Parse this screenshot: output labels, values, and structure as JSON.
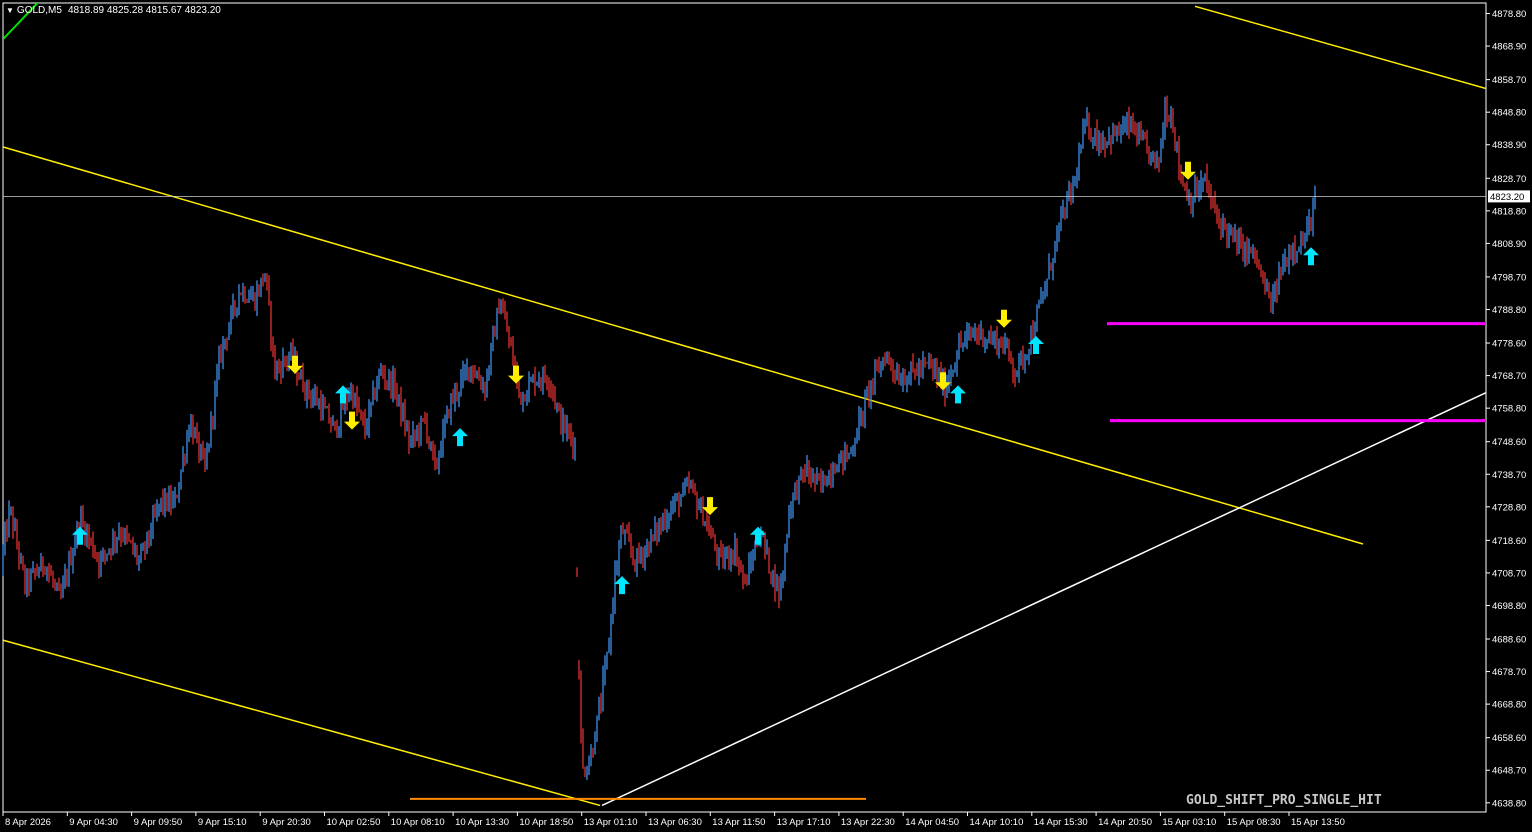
{
  "header": {
    "symbol": "GOLD,M5",
    "ohlc": "4818.89 4825.28 4815.67 4823.20"
  },
  "watermark": "GOLD_SHIFT_PRO_SINGLE_HIT",
  "current_price_label": "4823.20",
  "colors": {
    "background": "#000000",
    "candle_up": "#3d8ee8",
    "candle_down": "#e03030",
    "trend_line": "#ffee00",
    "support_line": "#ffffff",
    "zone_line": "#ff00ff",
    "low_line": "#ff8c00",
    "green_line": "#00e000",
    "arrow_up": "#00e5ff",
    "arrow_down": "#ffee00",
    "axis_text": "#ffffff",
    "grid_frame": "#ffffff"
  },
  "chart_data": {
    "type": "candlestick",
    "ylim": [
      4636.0,
      4882.0
    ],
    "y_ticks": [
      "4878.80",
      "4868.90",
      "4858.70",
      "4848.80",
      "4838.90",
      "4828.70",
      "4818.80",
      "4808.90",
      "4798.70",
      "4788.80",
      "4778.60",
      "4768.70",
      "4758.80",
      "4748.60",
      "4738.70",
      "4728.80",
      "4718.60",
      "4708.70",
      "4698.80",
      "4688.60",
      "4678.70",
      "4668.80",
      "4658.60",
      "4648.70",
      "4638.80"
    ],
    "x_ticks": [
      "8 Apr 2026",
      "9 Apr 04:30",
      "9 Apr 09:50",
      "9 Apr 15:10",
      "9 Apr 20:30",
      "10 Apr 02:50",
      "10 Apr 08:10",
      "10 Apr 13:30",
      "10 Apr 18:50",
      "13 Apr 01:10",
      "13 Apr 06:30",
      "13 Apr 11:50",
      "13 Apr 17:10",
      "13 Apr 22:30",
      "14 Apr 04:50",
      "14 Apr 10:10",
      "14 Apr 15:30",
      "14 Apr 20:50",
      "15 Apr 03:10",
      "15 Apr 08:30",
      "15 Apr 13:50"
    ],
    "current_price": 4823.2,
    "price_path": [
      [
        0,
        4710
      ],
      [
        10,
        4728
      ],
      [
        25,
        4705
      ],
      [
        45,
        4712
      ],
      [
        60,
        4700
      ],
      [
        80,
        4725
      ],
      [
        100,
        4712
      ],
      [
        120,
        4722
      ],
      [
        140,
        4712
      ],
      [
        160,
        4730
      ],
      [
        175,
        4730
      ],
      [
        190,
        4755
      ],
      [
        205,
        4740
      ],
      [
        220,
        4775
      ],
      [
        240,
        4795
      ],
      [
        255,
        4792
      ],
      [
        265,
        4800
      ],
      [
        275,
        4770
      ],
      [
        290,
        4775
      ],
      [
        305,
        4765
      ],
      [
        320,
        4760
      ],
      [
        335,
        4752
      ],
      [
        350,
        4765
      ],
      [
        365,
        4752
      ],
      [
        380,
        4770
      ],
      [
        395,
        4765
      ],
      [
        410,
        4748
      ],
      [
        425,
        4755
      ],
      [
        435,
        4740
      ],
      [
        450,
        4760
      ],
      [
        470,
        4772
      ],
      [
        485,
        4765
      ],
      [
        500,
        4792
      ],
      [
        510,
        4778
      ],
      [
        520,
        4762
      ],
      [
        535,
        4768
      ],
      [
        550,
        4768
      ],
      [
        560,
        4755
      ],
      [
        575,
        4748
      ],
      [
        578,
        4690
      ],
      [
        582,
        4648
      ],
      [
        590,
        4652
      ],
      [
        600,
        4668
      ],
      [
        608,
        4685
      ],
      [
        615,
        4708
      ],
      [
        622,
        4722
      ],
      [
        635,
        4712
      ],
      [
        650,
        4718
      ],
      [
        670,
        4728
      ],
      [
        690,
        4735
      ],
      [
        705,
        4725
      ],
      [
        720,
        4712
      ],
      [
        735,
        4716
      ],
      [
        745,
        4705
      ],
      [
        760,
        4722
      ],
      [
        770,
        4710
      ],
      [
        780,
        4702
      ],
      [
        790,
        4730
      ],
      [
        805,
        4740
      ],
      [
        820,
        4735
      ],
      [
        835,
        4742
      ],
      [
        850,
        4745
      ],
      [
        860,
        4755
      ],
      [
        870,
        4765
      ],
      [
        885,
        4775
      ],
      [
        900,
        4768
      ],
      [
        915,
        4770
      ],
      [
        930,
        4772
      ],
      [
        945,
        4765
      ],
      [
        960,
        4778
      ],
      [
        975,
        4782
      ],
      [
        990,
        4780
      ],
      [
        1005,
        4778
      ],
      [
        1015,
        4770
      ],
      [
        1025,
        4775
      ],
      [
        1035,
        4785
      ],
      [
        1045,
        4795
      ],
      [
        1060,
        4815
      ],
      [
        1075,
        4828
      ],
      [
        1085,
        4845
      ],
      [
        1100,
        4840
      ],
      [
        1115,
        4842
      ],
      [
        1130,
        4845
      ],
      [
        1145,
        4838
      ],
      [
        1158,
        4832
      ],
      [
        1165,
        4850
      ],
      [
        1172,
        4848
      ],
      [
        1180,
        4830
      ],
      [
        1190,
        4822
      ],
      [
        1205,
        4828
      ],
      [
        1215,
        4818
      ],
      [
        1228,
        4812
      ],
      [
        1240,
        4808
      ],
      [
        1255,
        4805
      ],
      [
        1265,
        4795
      ],
      [
        1272,
        4790
      ],
      [
        1280,
        4800
      ],
      [
        1292,
        4808
      ],
      [
        1305,
        4810
      ],
      [
        1316,
        4823
      ]
    ],
    "signals": [
      {
        "type": "up",
        "x": 80,
        "price": 4720
      },
      {
        "type": "down",
        "x": 295,
        "price": 4772
      },
      {
        "type": "up",
        "x": 343,
        "price": 4763
      },
      {
        "type": "down",
        "x": 352,
        "price": 4755
      },
      {
        "type": "up",
        "x": 460,
        "price": 4750
      },
      {
        "type": "down",
        "x": 516,
        "price": 4769
      },
      {
        "type": "up",
        "x": 622,
        "price": 4705
      },
      {
        "type": "down",
        "x": 710,
        "price": 4729
      },
      {
        "type": "up",
        "x": 758,
        "price": 4720
      },
      {
        "type": "down",
        "x": 943,
        "price": 4767
      },
      {
        "type": "up",
        "x": 958,
        "price": 4763
      },
      {
        "type": "down",
        "x": 1004,
        "price": 4786
      },
      {
        "type": "up",
        "x": 1036,
        "price": 4778
      },
      {
        "type": "down",
        "x": 1188,
        "price": 4831
      },
      {
        "type": "up",
        "x": 1311,
        "price": 4805
      }
    ],
    "lines": [
      {
        "kind": "trend",
        "p1": [
          0,
          4838.5
        ],
        "p2": [
          1363,
          4717.5
        ]
      },
      {
        "kind": "trend",
        "p1": [
          1195,
          4881
        ],
        "p2": [
          1486,
          4856
        ]
      },
      {
        "kind": "trend",
        "p1": [
          0,
          4688.5
        ],
        "p2": [
          600,
          4638
        ]
      },
      {
        "kind": "support",
        "p1": [
          602,
          4638
        ],
        "p2": [
          1486,
          4763.5
        ]
      },
      {
        "kind": "zone",
        "p1": [
          1107,
          4784.5
        ],
        "p2": [
          1486,
          4784.5
        ]
      },
      {
        "kind": "zone",
        "p1": [
          1110,
          4755
        ],
        "p2": [
          1486,
          4755
        ]
      },
      {
        "kind": "low",
        "p1": [
          410,
          4640
        ],
        "p2": [
          866,
          4640
        ]
      },
      {
        "kind": "green",
        "p1": [
          3,
          4871
        ],
        "p2": [
          47,
          4885
        ]
      }
    ]
  }
}
